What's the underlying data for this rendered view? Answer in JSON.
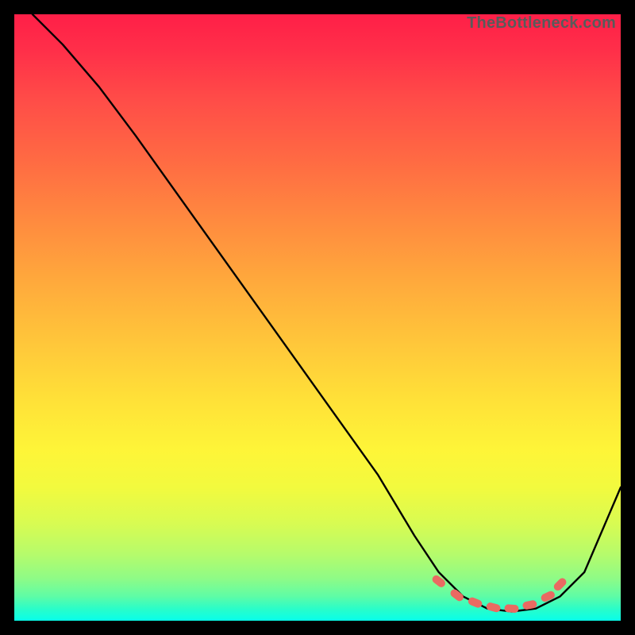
{
  "attribution": "TheBottleneck.com",
  "chart_data": {
    "type": "line",
    "title": "",
    "xlabel": "",
    "ylabel": "",
    "xlim": [
      0,
      100
    ],
    "ylim": [
      0,
      100
    ],
    "series": [
      {
        "name": "curve",
        "x": [
          3,
          8,
          14,
          20,
          30,
          40,
          50,
          60,
          66,
          70,
          74,
          78,
          82,
          86,
          90,
          94,
          100
        ],
        "y": [
          100,
          95,
          88,
          80,
          66,
          52,
          38,
          24,
          14,
          8,
          4,
          2,
          1.5,
          2,
          4,
          8,
          22
        ]
      }
    ],
    "markers": {
      "name": "highlight-segment",
      "color": "#e96a62",
      "x": [
        70,
        73,
        76,
        79,
        82,
        85,
        88,
        90
      ],
      "y": [
        6.5,
        4.2,
        3.0,
        2.2,
        2.0,
        2.6,
        4.0,
        6.0
      ]
    }
  }
}
